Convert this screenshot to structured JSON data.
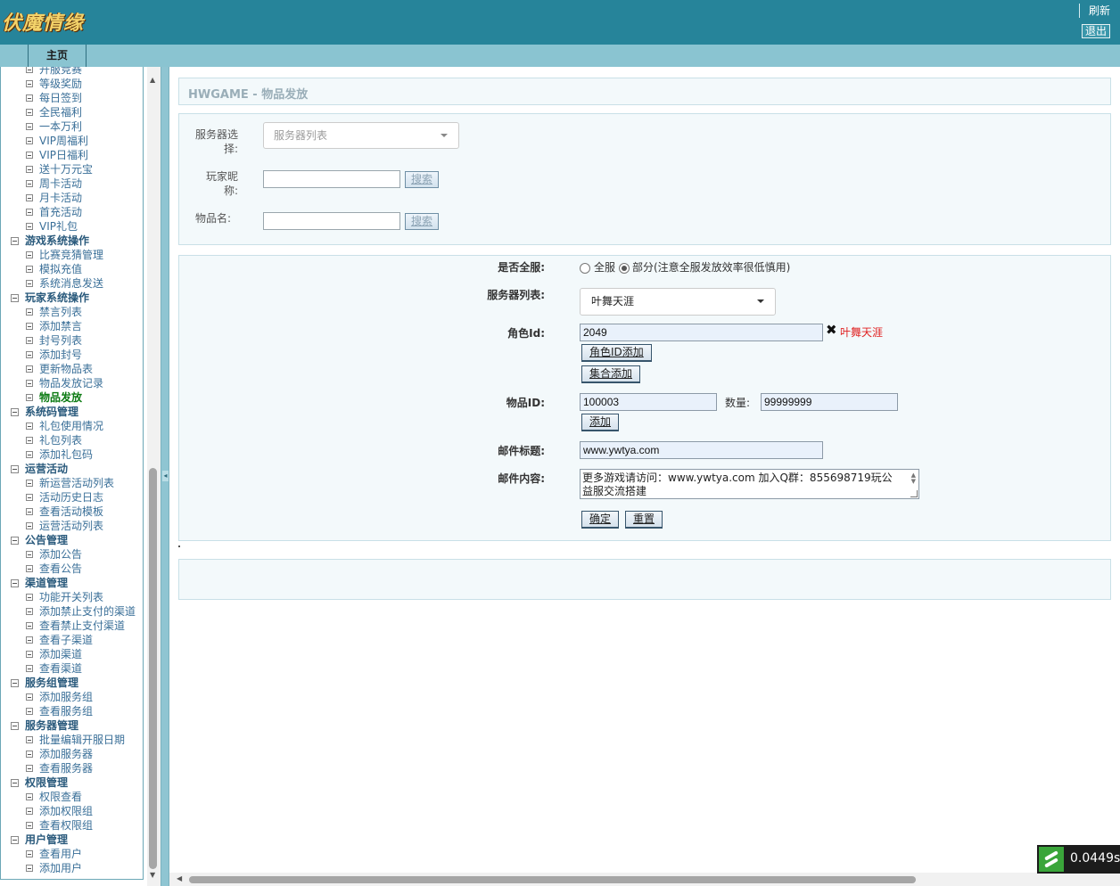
{
  "header": {
    "logo_text": "伏魔情缘",
    "refresh_label": "刷新",
    "logout_label": "退出"
  },
  "tabs": {
    "home_label": "主页"
  },
  "sidebar": {
    "rows": [
      {
        "label": "开服竞赛",
        "kind": "leaf"
      },
      {
        "label": "等级奖励",
        "kind": "leaf"
      },
      {
        "label": "每日签到",
        "kind": "leaf"
      },
      {
        "label": "全民福利",
        "kind": "leaf"
      },
      {
        "label": "一本万利",
        "kind": "leaf"
      },
      {
        "label": "VIP周福利",
        "kind": "leaf"
      },
      {
        "label": "VIP日福利",
        "kind": "leaf"
      },
      {
        "label": "送十万元宝",
        "kind": "leaf"
      },
      {
        "label": "周卡活动",
        "kind": "leaf"
      },
      {
        "label": "月卡活动",
        "kind": "leaf"
      },
      {
        "label": "首充活动",
        "kind": "leaf"
      },
      {
        "label": "VIP礼包",
        "kind": "leaf"
      },
      {
        "label": "游戏系统操作",
        "kind": "group"
      },
      {
        "label": "比赛竞猜管理",
        "kind": "leaf"
      },
      {
        "label": "模拟充值",
        "kind": "leaf"
      },
      {
        "label": "系统消息发送",
        "kind": "leaf"
      },
      {
        "label": "玩家系统操作",
        "kind": "group"
      },
      {
        "label": "禁言列表",
        "kind": "leaf"
      },
      {
        "label": "添加禁言",
        "kind": "leaf"
      },
      {
        "label": "封号列表",
        "kind": "leaf"
      },
      {
        "label": "添加封号",
        "kind": "leaf"
      },
      {
        "label": "更新物品表",
        "kind": "leaf"
      },
      {
        "label": "物品发放记录",
        "kind": "leaf"
      },
      {
        "label": "物品发放",
        "kind": "leaf",
        "active": true
      },
      {
        "label": "系统码管理",
        "kind": "group"
      },
      {
        "label": "礼包使用情况",
        "kind": "leaf"
      },
      {
        "label": "礼包列表",
        "kind": "leaf"
      },
      {
        "label": "添加礼包码",
        "kind": "leaf"
      },
      {
        "label": "运营活动",
        "kind": "group"
      },
      {
        "label": "新运营活动列表",
        "kind": "leaf"
      },
      {
        "label": "活动历史日志",
        "kind": "leaf"
      },
      {
        "label": "查看活动模板",
        "kind": "leaf"
      },
      {
        "label": "运营活动列表",
        "kind": "leaf"
      },
      {
        "label": "公告管理",
        "kind": "group"
      },
      {
        "label": "添加公告",
        "kind": "leaf"
      },
      {
        "label": "查看公告",
        "kind": "leaf"
      },
      {
        "label": "渠道管理",
        "kind": "group"
      },
      {
        "label": "功能开关列表",
        "kind": "leaf"
      },
      {
        "label": "添加禁止支付的渠道",
        "kind": "leaf"
      },
      {
        "label": "查看禁止支付渠道",
        "kind": "leaf"
      },
      {
        "label": "查看子渠道",
        "kind": "leaf"
      },
      {
        "label": "添加渠道",
        "kind": "leaf"
      },
      {
        "label": "查看渠道",
        "kind": "leaf"
      },
      {
        "label": "服务组管理",
        "kind": "group"
      },
      {
        "label": "添加服务组",
        "kind": "leaf"
      },
      {
        "label": "查看服务组",
        "kind": "leaf"
      },
      {
        "label": "服务器管理",
        "kind": "group"
      },
      {
        "label": "批量编辑开服日期",
        "kind": "leaf"
      },
      {
        "label": "添加服务器",
        "kind": "leaf"
      },
      {
        "label": "查看服务器",
        "kind": "leaf"
      },
      {
        "label": "权限管理",
        "kind": "group"
      },
      {
        "label": "权限查看",
        "kind": "leaf"
      },
      {
        "label": "添加权限组",
        "kind": "leaf"
      },
      {
        "label": "查看权限组",
        "kind": "leaf"
      },
      {
        "label": "用户管理",
        "kind": "group"
      },
      {
        "label": "查看用户",
        "kind": "leaf"
      },
      {
        "label": "添加用户",
        "kind": "leaf"
      }
    ]
  },
  "page": {
    "title": "HWGAME - 物品发放"
  },
  "search": {
    "server_label": "服务器选择:",
    "server_placeholder": "服务器列表",
    "player_label": "玩家昵称:",
    "player_value": "",
    "player_button": "搜索",
    "item_label": "物品名:",
    "item_value": "",
    "item_button": "搜索"
  },
  "form": {
    "all_server_label": "是否全服:",
    "radio_all": "全服",
    "radio_partial": "部分(注意全服发放效率很低慎用)",
    "server_list_label": "服务器列表:",
    "server_selected": "叶舞天涯",
    "role_id_label": "角色Id:",
    "role_id_value": "2049",
    "role_name": "叶舞天涯",
    "add_role_button": "角色ID添加",
    "batch_add_button": "集合添加",
    "item_id_label": "物品ID:",
    "item_id_value": "100003",
    "qty_label": "数量:",
    "qty_value": "99999999",
    "add_button": "添加",
    "mail_title_label": "邮件标题:",
    "mail_title_value": "www.ywtya.com",
    "mail_content_label": "邮件内容:",
    "mail_content_value": "更多游戏请访问：www.ywtya.com  加入Q群：855698719玩公益服交流搭建",
    "confirm_button": "确定",
    "reset_button": "重置"
  },
  "timer": {
    "value": "0.0449s"
  }
}
